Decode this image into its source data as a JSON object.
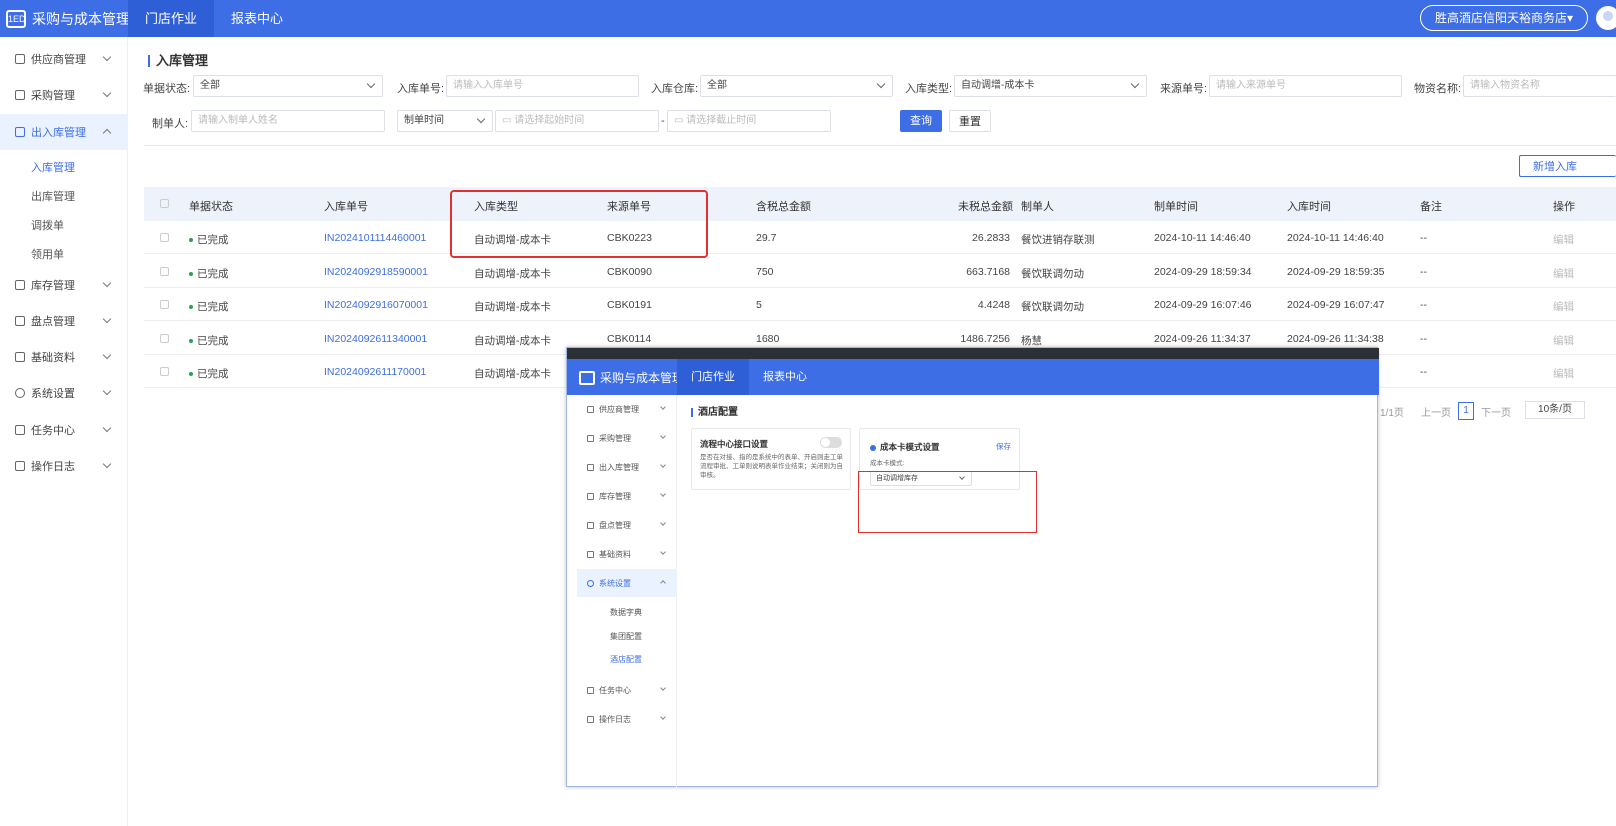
{
  "app": {
    "title": "采购与成本管理",
    "logo_text": "1ED"
  },
  "topnav": [
    {
      "label": "门店作业",
      "active": true
    },
    {
      "label": "报表中心",
      "active": false
    }
  ],
  "store": {
    "label": "胜高酒店信阳天裕商务店▾"
  },
  "sidebar": {
    "items": [
      {
        "label": "供应商管理",
        "icon": "supplier-icon"
      },
      {
        "label": "采购管理",
        "icon": "purchase-icon"
      },
      {
        "label": "出入库管理",
        "icon": "inout-icon",
        "active": true
      },
      {
        "label": "库存管理",
        "icon": "inventory-icon"
      },
      {
        "label": "盘点管理",
        "icon": "stocktake-icon"
      },
      {
        "label": "基础资料",
        "icon": "basic-data-icon"
      },
      {
        "label": "系统设置",
        "icon": "settings-icon"
      },
      {
        "label": "任务中心",
        "icon": "task-icon"
      },
      {
        "label": "操作日志",
        "icon": "log-icon"
      }
    ],
    "subitems": [
      {
        "label": "入库管理",
        "active": true
      },
      {
        "label": "出库管理"
      },
      {
        "label": "调拨单"
      },
      {
        "label": "领用单"
      }
    ]
  },
  "page": {
    "title": "入库管理"
  },
  "filters": {
    "status": {
      "label": "单据状态:",
      "value": "全部"
    },
    "inbound_no": {
      "label": "入库单号:",
      "placeholder": "请输入入库单号"
    },
    "warehouse": {
      "label": "入库仓库:",
      "value": "全部"
    },
    "inbound_type": {
      "label": "入库类型:",
      "value": "自动调增-成本卡"
    },
    "source_no": {
      "label": "来源单号:",
      "placeholder": "请输入来源单号"
    },
    "material": {
      "label": "物资名称:",
      "placeholder": "请输入物资名称"
    },
    "maker": {
      "label": "制单人:",
      "placeholder": "请输入制单人姓名"
    },
    "time_type": {
      "value": "制单时间"
    },
    "start_time": {
      "placeholder": "请选择起始时间"
    },
    "range_sep": "-",
    "end_time": {
      "placeholder": "请选择截止时间"
    },
    "query_label": "查询",
    "reset_label": "重置"
  },
  "new_button": "新增入库",
  "table": {
    "columns": [
      "单据状态",
      "入库单号",
      "入库类型",
      "来源单号",
      "含税总金额",
      "未税总金额",
      "制单人",
      "制单时间",
      "入库时间",
      "备注",
      "操作"
    ],
    "rows": [
      {
        "status": "已完成",
        "no": "IN2024101114460001",
        "type": "自动调增-成本卡",
        "source": "CBK0223",
        "tax": "29.7",
        "notax": "26.2833",
        "maker": "餐饮进销存联测",
        "created": "2024-10-11 14:46:40",
        "inbound": "2024-10-11 14:46:40",
        "remark": "--",
        "op": "编辑"
      },
      {
        "status": "已完成",
        "no": "IN2024092918590001",
        "type": "自动调增-成本卡",
        "source": "CBK0090",
        "tax": "750",
        "notax": "663.7168",
        "maker": "餐饮联调勿动",
        "created": "2024-09-29 18:59:34",
        "inbound": "2024-09-29 18:59:35",
        "remark": "--",
        "op": "编辑"
      },
      {
        "status": "已完成",
        "no": "IN2024092916070001",
        "type": "自动调增-成本卡",
        "source": "CBK0191",
        "tax": "5",
        "notax": "4.4248",
        "maker": "餐饮联调勿动",
        "created": "2024-09-29 16:07:46",
        "inbound": "2024-09-29 16:07:47",
        "remark": "--",
        "op": "编辑"
      },
      {
        "status": "已完成",
        "no": "IN2024092611340001",
        "type": "自动调增-成本卡",
        "source": "CBK0114",
        "tax": "1680",
        "notax": "1486.7256",
        "maker": "杨慧",
        "created": "2024-09-26 11:34:37",
        "inbound": "2024-09-26 11:34:38",
        "remark": "--",
        "op": "编辑"
      },
      {
        "status": "已完成",
        "no": "IN2024092611170001",
        "type": "自动调增-成本卡",
        "source": "",
        "tax": "",
        "notax": "",
        "maker": "",
        "created": "",
        "inbound": "",
        "remark": "--",
        "op": "编辑"
      }
    ]
  },
  "pager": {
    "pages": "1/1页",
    "prev": "上一页",
    "current": "1",
    "next": "下一页",
    "size": "10条/页"
  },
  "inset": {
    "app_title": "采购与成本管理",
    "topnav": [
      "门店作业",
      "报表中心"
    ],
    "sidebar": [
      "供应商管理",
      "采购管理",
      "出入库管理",
      "库存管理",
      "盘点管理",
      "基础资料",
      "系统设置",
      "任务中心",
      "操作日志"
    ],
    "subitems": [
      "数据字典",
      "集团配置",
      "酒店配置"
    ],
    "page_title": "酒店配置",
    "card1": {
      "title": "流程中心接口设置",
      "desc": "是否在对接、指的是系统中的表单、开启则走工单流程审批、工单则说明表单作业结束；关闭则为自审核。"
    },
    "card2": {
      "title": "成本卡模式设置",
      "save": "保存",
      "field_label": "成本卡模式:",
      "value": "自动调增库存"
    }
  },
  "colors": {
    "primary": "#3d6ee6",
    "highlight": "#e03131",
    "success": "#2aa34a"
  }
}
